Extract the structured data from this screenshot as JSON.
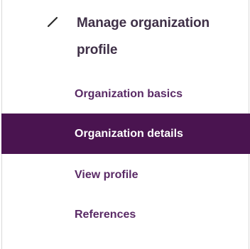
{
  "header": {
    "icon": "pencil-icon",
    "title": "Manage organization profile"
  },
  "nav": {
    "items": [
      {
        "label": "Organization basics",
        "active": false
      },
      {
        "label": "Organization details",
        "active": true
      },
      {
        "label": "View profile",
        "active": false
      },
      {
        "label": "References",
        "active": false
      }
    ]
  },
  "colors": {
    "active_bg": "#4a1450",
    "link": "#5a2a66",
    "heading": "#3f3047"
  }
}
